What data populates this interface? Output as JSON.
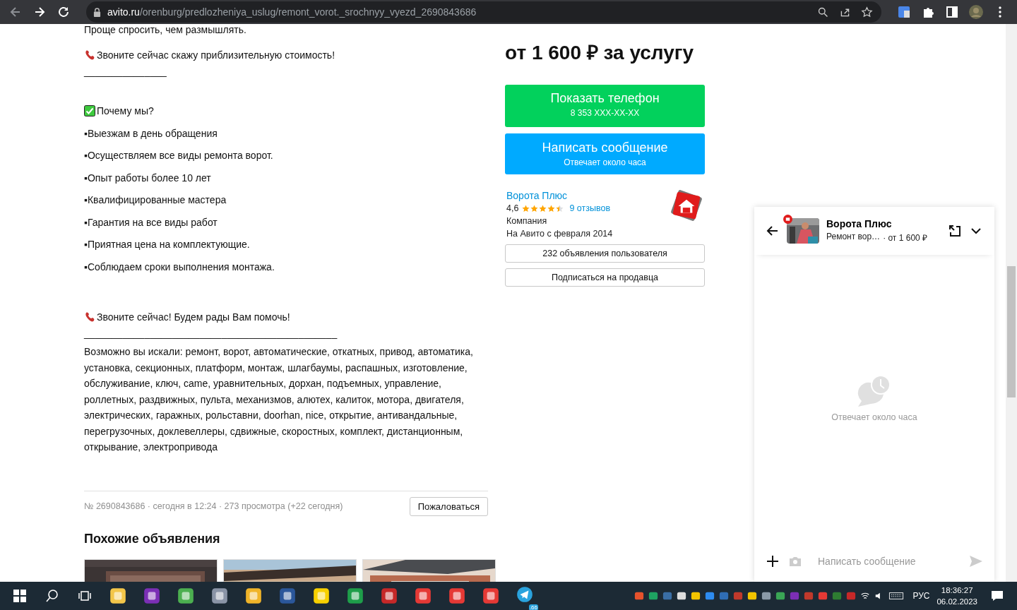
{
  "browser": {
    "address": {
      "host": "avito.ru",
      "path": "/orenburg/predlozheniya_uslug/remont_vorot._srochnyy_vyezd_2690843686"
    }
  },
  "description": [
    {
      "kind": "cut",
      "text": "Проще спросить, чем размышлять."
    },
    {
      "kind": "phone",
      "text": "Звоните сейчас скажу приблизительную стоимость!"
    },
    {
      "kind": "rule",
      "text": "_______________"
    },
    {
      "kind": "gap"
    },
    {
      "kind": "check",
      "text": "Почему мы?"
    },
    {
      "kind": "bullet",
      "text": "▪Выезжам в день обращения"
    },
    {
      "kind": "bullet",
      "text": "▪Осуществляем все виды ремонта ворот."
    },
    {
      "kind": "bullet",
      "text": "▪Опыт работы более 10 лет"
    },
    {
      "kind": "bullet",
      "text": "▪Квалифицированные мастера"
    },
    {
      "kind": "bullet",
      "text": "▪Гарантия на все виды работ"
    },
    {
      "kind": "bullet",
      "text": "▪Приятная цена на комплектующие."
    },
    {
      "kind": "bullet",
      "text": "▪Соблюдаем сроки выполнения монтажа."
    },
    {
      "kind": "gap"
    },
    {
      "kind": "phone",
      "text": "Звоните сейчас! Будем рады Вам помочь!"
    },
    {
      "kind": "rule",
      "text": "______________________________________________"
    },
    {
      "kind": "para",
      "text": "Возможно вы искали: ремонт, ворот, автоматические, откатных, привод, автоматика, установка, секционных, платформ, монтаж, шлагбаумы, распашных, изготовление, обслуживание, ключ, came, уравнительных, дорхан, подъемных, управление, роллетных, раздвижных, пульта, механизмов, алютех, калиток, мотора, двигателя, электрических, гаражных, рольставни, doorhan, nice, открытие, антивандальные, перегрузочных, доклевеллеры, сдвижные, скоростных, комплект, дистанционным, открывание, электропривода"
    }
  ],
  "meta": {
    "text": "№ 2690843686 · сегодня в 12:24 · 273 просмотра (+22 сегодня)",
    "report_button": "Пожаловаться"
  },
  "similar": {
    "title": "Похожие объявления"
  },
  "price": "от 1 600 ₽ за услугу",
  "phone_button": {
    "label": "Показать телефон",
    "sub": "8 353 XXX-XX-XX"
  },
  "message_button": {
    "label": "Написать сообщение",
    "sub": "Отвечает около часа"
  },
  "seller": {
    "name": "Ворота Плюс",
    "rating": "4,6",
    "stars": 4.5,
    "reviews": "9 отзывов",
    "type": "Компания",
    "since": "На Авито с февраля 2014"
  },
  "seller_buttons": [
    "232 объявления пользователя",
    "Подписаться на продавца"
  ],
  "chat": {
    "name": "Ворота Плюс",
    "item": "Ремонт вор…",
    "price": "· от 1 600 ₽",
    "empty_text": "Отвечает около часа",
    "input": {
      "placeholder": "Написать сообщение"
    }
  },
  "taskbar": {
    "telegram_badge": ".66",
    "language": "РУС",
    "time": "18:36:27",
    "date": "06.02.2023"
  }
}
